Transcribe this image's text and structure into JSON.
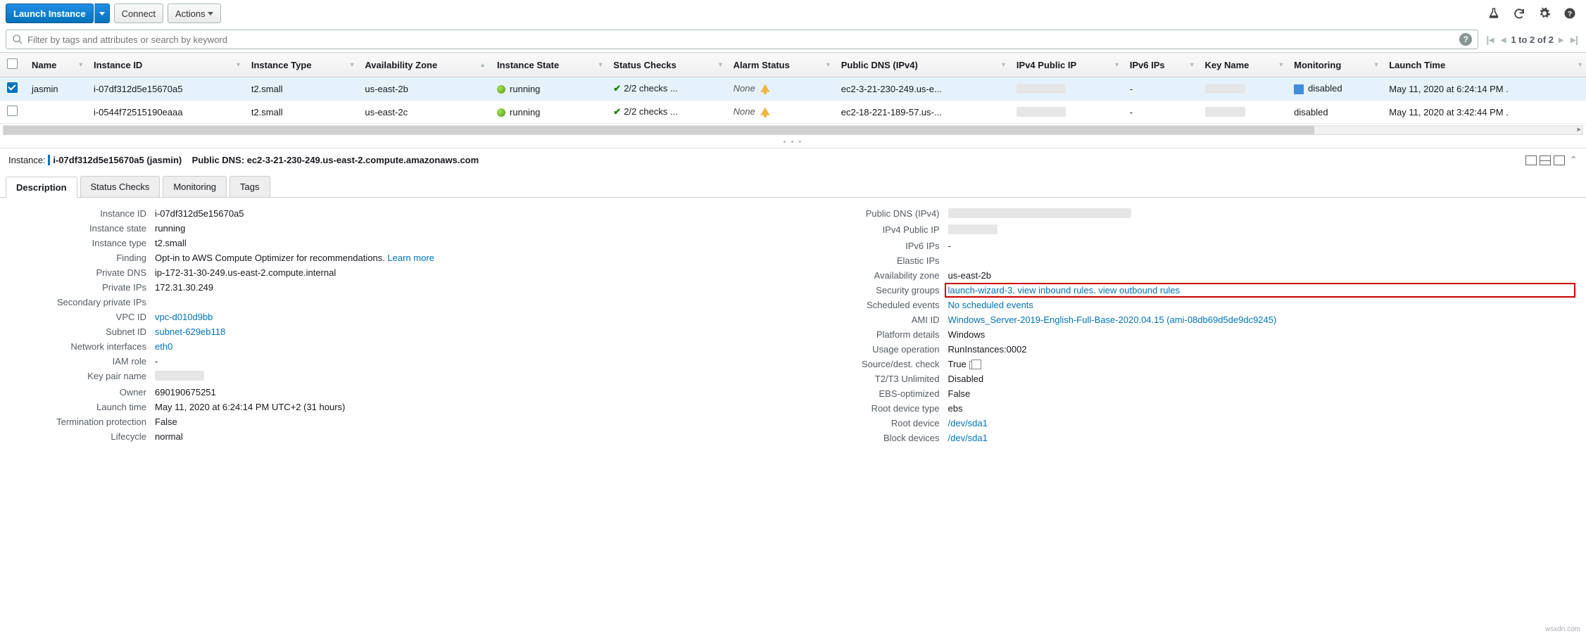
{
  "toolbar": {
    "launch": "Launch Instance",
    "connect": "Connect",
    "actions": "Actions"
  },
  "search": {
    "placeholder": "Filter by tags and attributes or search by keyword"
  },
  "pager": {
    "text": "1 to 2 of 2"
  },
  "columns": [
    "",
    "Name",
    "Instance ID",
    "Instance Type",
    "Availability Zone",
    "Instance State",
    "Status Checks",
    "Alarm Status",
    "Public DNS (IPv4)",
    "IPv4 Public IP",
    "IPv6 IPs",
    "Key Name",
    "Monitoring",
    "Launch Time"
  ],
  "rows": [
    {
      "sel": true,
      "name": "jasmin",
      "id": "i-07df312d5e15670a5",
      "type": "t2.small",
      "az": "us-east-2b",
      "state": "running",
      "checks": "2/2 checks ...",
      "alarm": "None",
      "dns": "ec2-3-21-230-249.us-e...",
      "ipv4": "[redacted]",
      "ipv6": "-",
      "key": "[redacted]",
      "mon": "disabled",
      "monbox": true,
      "launch": "May 11, 2020 at 6:24:14 PM ."
    },
    {
      "sel": false,
      "name": "",
      "id": "i-0544f72515190eaaa",
      "type": "t2.small",
      "az": "us-east-2c",
      "state": "running",
      "checks": "2/2 checks ...",
      "alarm": "None",
      "dns": "ec2-18-221-189-57.us-...",
      "ipv4": "[redacted]",
      "ipv6": "-",
      "key": "[redacted]",
      "mon": "disabled",
      "monbox": false,
      "launch": "May 11, 2020 at 3:42:44 PM ."
    }
  ],
  "instbar": {
    "label": "Instance:",
    "id": "i-07df312d5e15670a5 (jasmin)",
    "dnslabel": "Public DNS:",
    "dns": "ec2-3-21-230-249.us-east-2.compute.amazonaws.com"
  },
  "tabs": [
    "Description",
    "Status Checks",
    "Monitoring",
    "Tags"
  ],
  "left": [
    {
      "k": "Instance ID",
      "v": "i-07df312d5e15670a5"
    },
    {
      "k": "Instance state",
      "v": "running"
    },
    {
      "k": "Instance type",
      "v": "t2.small"
    },
    {
      "k": "Finding",
      "v": "Opt-in to AWS Compute Optimizer for recommendations. ",
      "link": "Learn more"
    },
    {
      "k": "Private DNS",
      "v": "ip-172-31-30-249.us-east-2.compute.internal"
    },
    {
      "k": "Private IPs",
      "v": "172.31.30.249"
    },
    {
      "k": "Secondary private IPs",
      "v": ""
    },
    {
      "k": "VPC ID",
      "v": "",
      "link": "vpc-d010d9bb"
    },
    {
      "k": "Subnet ID",
      "v": "",
      "link": "subnet-629eb118"
    },
    {
      "k": "Network interfaces",
      "v": "",
      "link": "eth0"
    },
    {
      "k": "IAM role",
      "v": "-"
    },
    {
      "k": "Key pair name",
      "v": "[redacted]"
    },
    {
      "k": "Owner",
      "v": "690190675251"
    },
    {
      "k": "Launch time",
      "v": "May 11, 2020 at 6:24:14 PM UTC+2 (31 hours)"
    },
    {
      "k": "Termination protection",
      "v": "False"
    },
    {
      "k": "Lifecycle",
      "v": "normal"
    }
  ],
  "right": [
    {
      "k": "Public DNS (IPv4)",
      "v": "[redacted-long]"
    },
    {
      "k": "IPv4 Public IP",
      "v": "[redacted]"
    },
    {
      "k": "IPv6 IPs",
      "v": "-"
    },
    {
      "k": "Elastic IPs",
      "v": ""
    },
    {
      "k": "Availability zone",
      "v": "us-east-2b"
    },
    {
      "k": "Security groups",
      "links": [
        "launch-wizard-3",
        ". ",
        "view inbound rules",
        ". ",
        "view outbound rules"
      ],
      "hl": true
    },
    {
      "k": "Scheduled events",
      "v": "",
      "link": "No scheduled events"
    },
    {
      "k": "AMI ID",
      "v": "",
      "link": "Windows_Server-2019-English-Full-Base-2020.04.15 (ami-08db69d5de9dc9245)"
    },
    {
      "k": "Platform details",
      "v": "Windows"
    },
    {
      "k": "Usage operation",
      "v": "RunInstances:0002"
    },
    {
      "k": "Source/dest. check",
      "v": "True",
      "copy": true
    },
    {
      "k": "T2/T3 Unlimited",
      "v": "Disabled"
    },
    {
      "k": "EBS-optimized",
      "v": "False"
    },
    {
      "k": "Root device type",
      "v": "ebs"
    },
    {
      "k": "Root device",
      "v": "",
      "link": "/dev/sda1"
    },
    {
      "k": "Block devices",
      "v": "",
      "link": "/dev/sda1"
    }
  ],
  "watermark": "wsxdn.com"
}
